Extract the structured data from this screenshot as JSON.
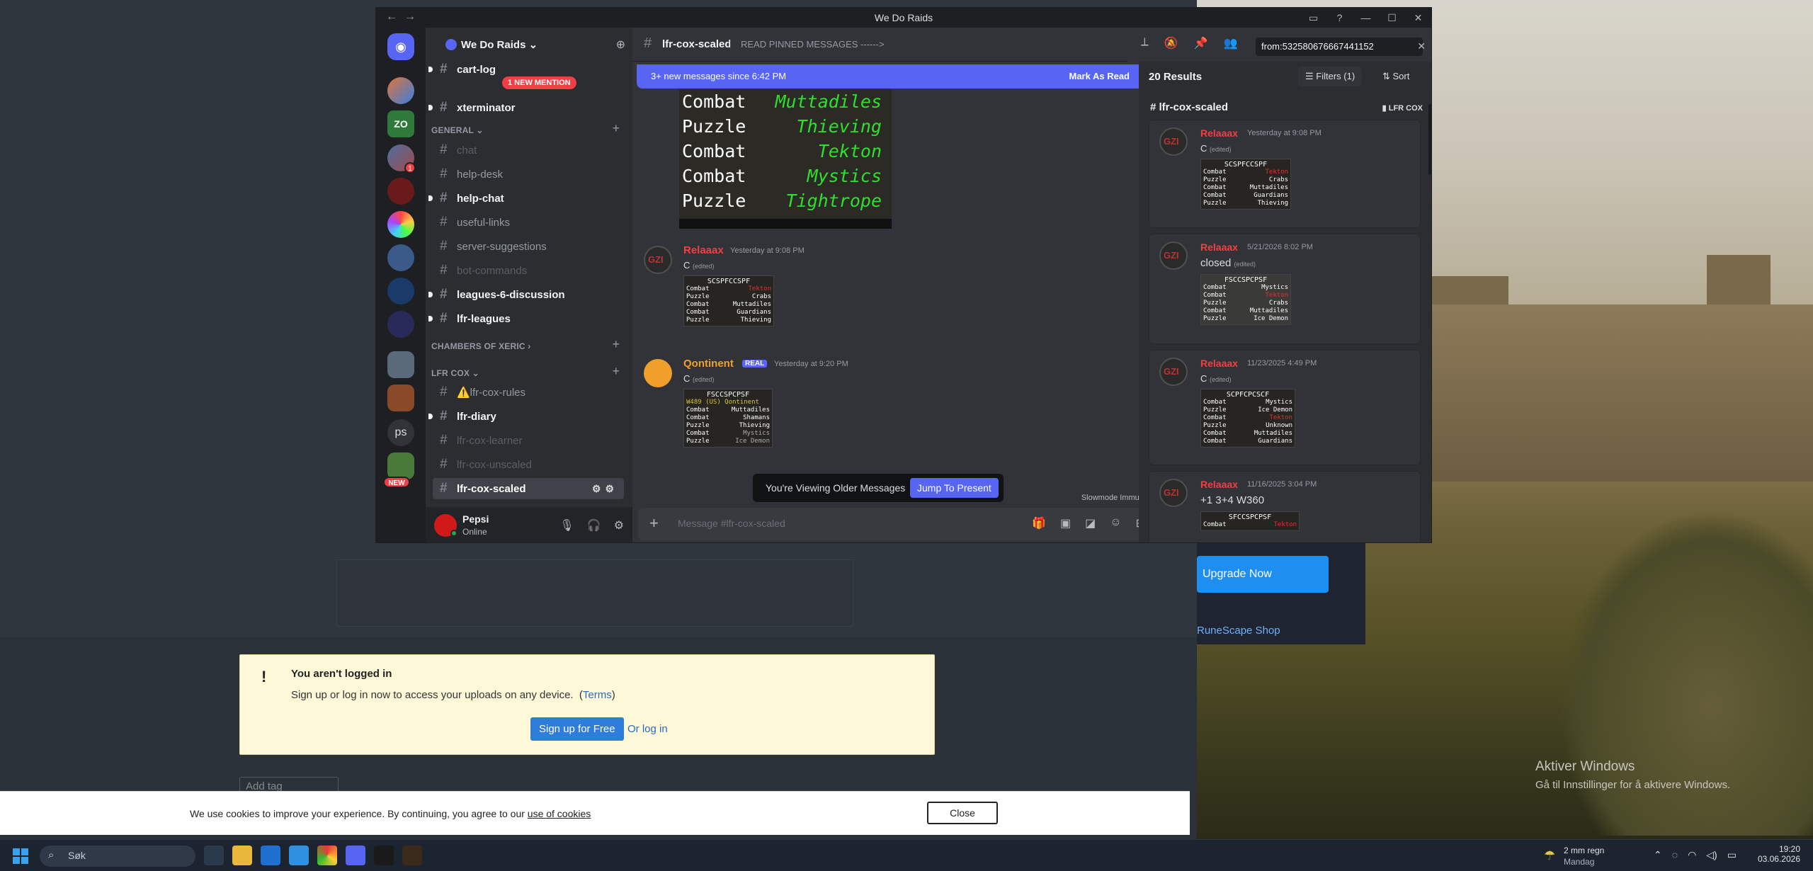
{
  "window": {
    "title": "We Do Raids",
    "nav_back": "←",
    "nav_forward": "→"
  },
  "guild": {
    "name": "We Do Raids ⌄"
  },
  "sidebar": {
    "mention_pill": "1 NEW MENTION",
    "new_badge": "NEW",
    "server_ps": "ps",
    "server_zo": "ZO",
    "server_badge": "1",
    "channels_top": [
      {
        "name": "cart-log",
        "state": "unread"
      },
      {
        "name": "xterminator",
        "state": "unread"
      }
    ],
    "categories": [
      {
        "name": "GENERAL ⌄"
      },
      {
        "name": "CHAMBERS OF XERIC ›"
      },
      {
        "name": "LFR COX ⌄"
      }
    ],
    "general_channels": [
      {
        "name": "chat",
        "state": "muted"
      },
      {
        "name": "help-desk",
        "state": "normal"
      },
      {
        "name": "help-chat",
        "state": "unread"
      },
      {
        "name": "useful-links",
        "state": "normal"
      },
      {
        "name": "server-suggestions",
        "state": "normal"
      },
      {
        "name": "bot-commands",
        "state": "muted"
      },
      {
        "name": "leagues-6-discussion",
        "state": "unread"
      },
      {
        "name": "lfr-leagues",
        "state": "unread"
      }
    ],
    "lfr_channels": [
      {
        "name": "⚠️lfr-cox-rules",
        "state": "normal"
      },
      {
        "name": "lfr-diary",
        "state": "unread"
      },
      {
        "name": "lfr-cox-learner",
        "state": "muted"
      },
      {
        "name": "lfr-cox-unscaled",
        "state": "muted"
      },
      {
        "name": "lfr-cox-scaled",
        "state": "selected"
      }
    ]
  },
  "user": {
    "name": "Pepsi",
    "status": "Online"
  },
  "channel": {
    "name": "lfr-cox-scaled",
    "topic": "READ PINNED MESSAGES ------>",
    "new_messages": "3+ new messages since 6:42 PM",
    "mark_read": "Mark As Read",
    "composer_placeholder": "Message #lfr-cox-scaled",
    "viewing_older": "You're Viewing Older Messages",
    "jump_present": "Jump To Present",
    "slowmode": "Slowmode Immune"
  },
  "big_image_rows": [
    {
      "a": "Combat",
      "b": "Muttadiles"
    },
    {
      "a": "Puzzle",
      "b": "Thieving"
    },
    {
      "a": "Combat",
      "b": "Tekton"
    },
    {
      "a": "Combat",
      "b": "Mystics"
    },
    {
      "a": "Puzzle",
      "b": "Tightrope"
    }
  ],
  "messages": [
    {
      "author": "Relaaax",
      "time": "Yesterday at 9:08 PM",
      "content": "C",
      "edited": "(edited)",
      "thumb_header": "SCSPFCCSPF",
      "thumb_rows": [
        {
          "a": "Combat",
          "b": "Tekton"
        },
        {
          "a": "Puzzle",
          "b": "Crabs"
        },
        {
          "a": "Combat",
          "b": "Muttadiles"
        },
        {
          "a": "Combat",
          "b": "Guardians"
        },
        {
          "a": "Puzzle",
          "b": "Thieving"
        }
      ]
    },
    {
      "author": "Qontinent",
      "badge": "REAL",
      "time": "Yesterday at 9:20 PM",
      "content": "C",
      "edited": "(edited)",
      "thumb_header": "FSCCSPCPSF",
      "thumb_sub": "W489 (US) Qontinent",
      "thumb_rows": [
        {
          "a": "Combat",
          "b": "Muttadiles"
        },
        {
          "a": "Combat",
          "b": "Shamans"
        },
        {
          "a": "Puzzle",
          "b": "Thieving"
        },
        {
          "a": "Combat",
          "b": "Mystics"
        },
        {
          "a": "Puzzle",
          "b": "Ice Demon"
        }
      ]
    }
  ],
  "search": {
    "query": "from:532580676667441152",
    "clear": "✕",
    "results_count": "20 Results",
    "filters": "Filters (1)",
    "sort": "Sort",
    "channel": "lfr-cox-scaled",
    "category_tag": "LFR COX",
    "results": [
      {
        "author": "Relaaax",
        "time": "Yesterday at 9:08 PM",
        "content": "C",
        "edited": "(edited)",
        "thumb_header": "SCSPFCCSPF",
        "rows": [
          {
            "a": "Combat",
            "b": "Tekton"
          },
          {
            "a": "Puzzle",
            "b": "Crabs"
          },
          {
            "a": "Combat",
            "b": "Muttadiles"
          },
          {
            "a": "Combat",
            "b": "Guardians"
          },
          {
            "a": "Puzzle",
            "b": "Thieving"
          }
        ]
      },
      {
        "author": "Relaaax",
        "time": "5/21/2026 8:02 PM",
        "content": "closed",
        "edited": "(edited)",
        "thumb_header": "FSCCSPCPSF",
        "rows": [
          {
            "a": "Combat",
            "b": "Mystics"
          },
          {
            "a": "Combat",
            "b": "Tekton"
          },
          {
            "a": "Puzzle",
            "b": "Crabs"
          },
          {
            "a": "Combat",
            "b": "Muttadiles"
          },
          {
            "a": "Puzzle",
            "b": "Ice Demon"
          }
        ]
      },
      {
        "author": "Relaaax",
        "time": "11/23/2025 4:49 PM",
        "content": "C",
        "edited": "(edited)",
        "thumb_header": "SCPFCPCSCF",
        "rows": [
          {
            "a": "Combat",
            "b": "Mystics"
          },
          {
            "a": "Puzzle",
            "b": "Ice Demon"
          },
          {
            "a": "Combat",
            "b": "Tekton"
          },
          {
            "a": "Puzzle",
            "b": "Unknown"
          },
          {
            "a": "Combat",
            "b": "Muttadiles"
          },
          {
            "a": "Combat",
            "b": "Guardians"
          }
        ]
      },
      {
        "author": "Relaaax",
        "time": "11/16/2025 3:04 PM",
        "content": "+1 3+4 W360",
        "thumb_header": "SFCCSPCPSF",
        "rows": [
          {
            "a": "Combat",
            "b": "Tekton"
          }
        ]
      }
    ]
  },
  "page": {
    "notice_title": "You aren't logged in",
    "notice_text": "Sign up or log in now to access your uploads on any device.",
    "notice_terms": "Terms",
    "signup": "Sign up for Free",
    "login": "Or log in",
    "add_tag": "Add tag",
    "cookie_text": "We use cookies to improve your experience. By continuing, you agree to our",
    "cookie_link": "use of cookies",
    "cookie_close": "Close",
    "upgrade": "Upgrade Now",
    "rs_shop": "RuneScape Shop"
  },
  "desktop": {
    "activate_title": "Aktiver Windows",
    "activate_sub": "Gå til Innstillinger for å aktivere Windows."
  },
  "taskbar": {
    "search": "Søk",
    "weather_line1": "2 mm regn",
    "weather_line2": "Mandag",
    "time": "19:20",
    "date": "03.06.2026"
  },
  "colors": {
    "accent": "#5865f2",
    "mention": "#f23f43",
    "online": "#23a55a",
    "author_red": "#f23f43",
    "author_orange": "#f0a02a"
  }
}
